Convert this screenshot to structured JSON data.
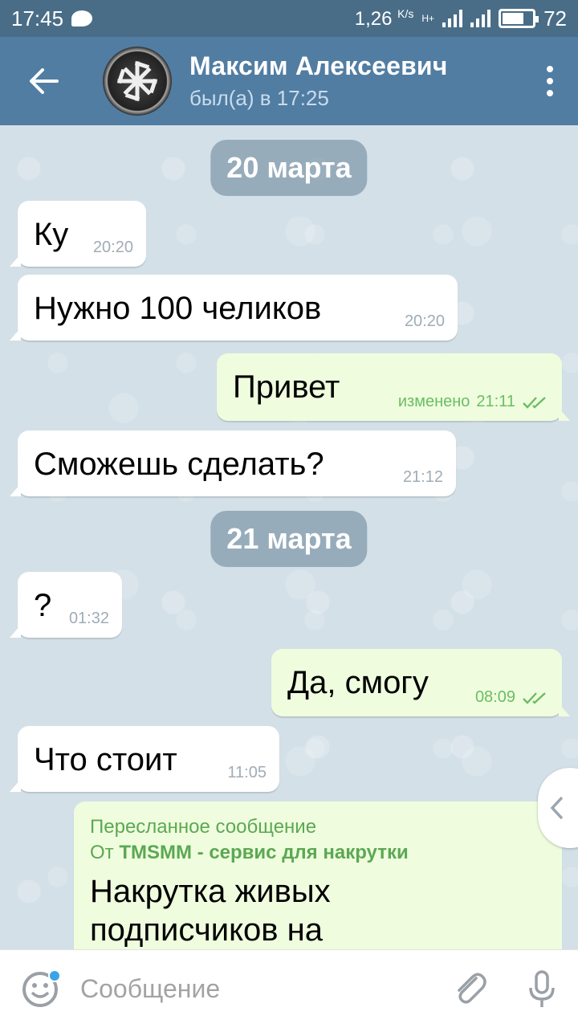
{
  "status_bar": {
    "time": "17:45",
    "speed": "1,26",
    "speed_unit": "K/s",
    "network": "H+",
    "battery": "72",
    "battery_level_percent": 72
  },
  "header": {
    "back_icon": "arrow-left-icon",
    "title": "Максим Алексеевич",
    "subtitle": "был(а) в 17:25",
    "menu_icon": "more-vert-icon"
  },
  "dates": [
    "20 марта",
    "21 марта"
  ],
  "messages": [
    {
      "dir": "in",
      "text": "Ку",
      "time": "20:20"
    },
    {
      "dir": "in",
      "text": "Нужно 100 челиков",
      "time": "20:20"
    },
    {
      "dir": "out",
      "text": "Привет",
      "edited": "изменено",
      "time": "21:11"
    },
    {
      "dir": "in",
      "text": "Сможешь сделать?",
      "time": "21:12"
    },
    {
      "dir": "in",
      "text": "?",
      "time": "01:32"
    },
    {
      "dir": "out",
      "text": "Да, смогу",
      "time": "08:09"
    },
    {
      "dir": "in",
      "text": "Что стоит",
      "time": "11:05"
    }
  ],
  "forwarded": {
    "label": "Пересланное сообщение",
    "from_prefix": "От",
    "from_name": "TMSMM - сервис для накрутки",
    "body_line1": "Накрутка живых",
    "body_line2": "подписчиков на"
  },
  "input": {
    "placeholder": "Сообщение",
    "emoji_icon": "emoji-icon",
    "attach_icon": "paperclip-icon",
    "mic_icon": "microphone-icon"
  },
  "colors": {
    "header": "#517da2",
    "status_bar": "#4a6d87",
    "outgoing_bubble": "#effdde",
    "incoming_bubble": "#ffffff",
    "check_green": "#6cbd62"
  }
}
